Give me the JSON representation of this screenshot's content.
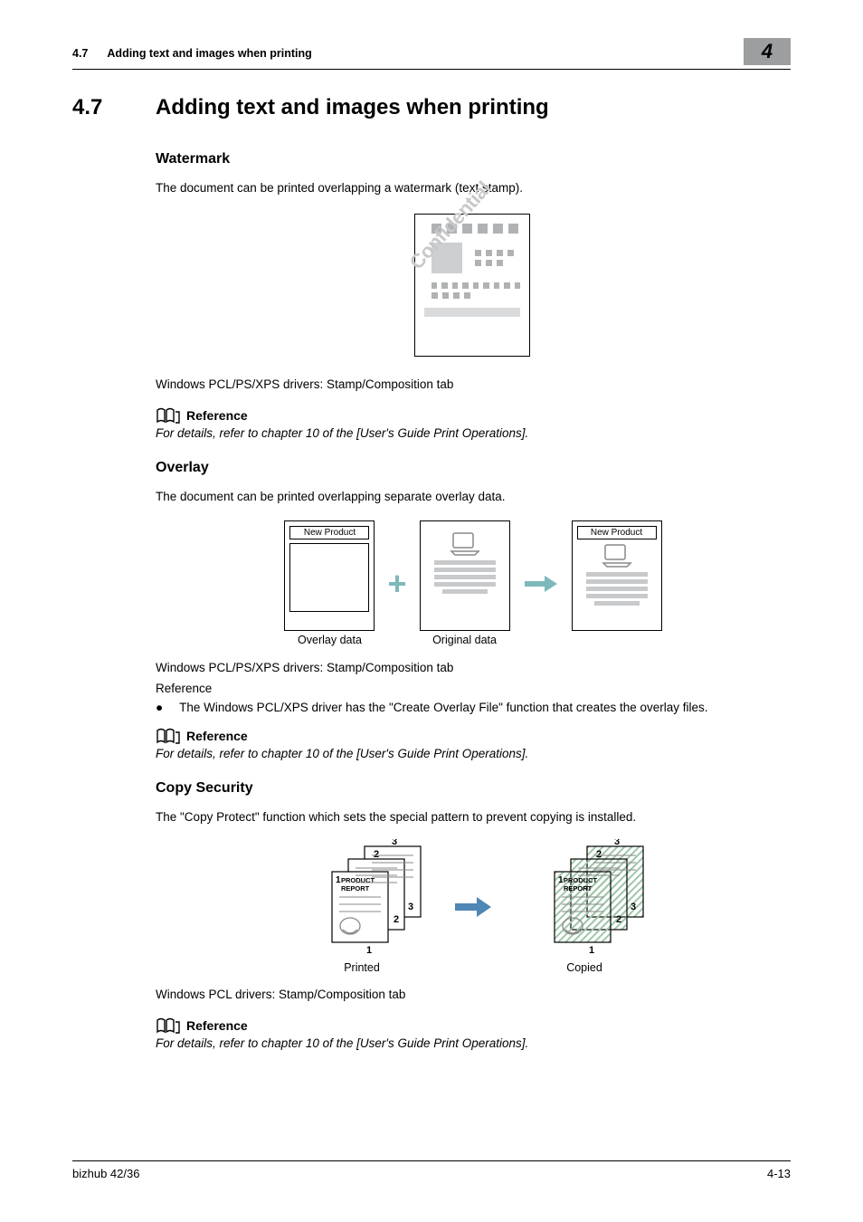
{
  "header": {
    "section_number": "4.7",
    "section_text": "Adding text and images when printing",
    "chapter_number": "4"
  },
  "section": {
    "number": "4.7",
    "title": "Adding text and images when printing"
  },
  "watermark": {
    "heading": "Watermark",
    "desc": "The document can be printed overlapping a watermark (text stamp).",
    "stamp_text": "Confidential",
    "drivers_line": "Windows PCL/PS/XPS drivers: Stamp/Composition tab",
    "reference_label": "Reference",
    "reference_text": "For details, refer to chapter 10 of the [User's Guide Print Operations]."
  },
  "overlay": {
    "heading": "Overlay",
    "desc": "The document can be printed overlapping separate overlay data.",
    "box_label": "New Product",
    "caption_left": "Overlay data",
    "caption_mid": "Original data",
    "drivers_line": "Windows PCL/PS/XPS drivers: Stamp/Composition tab",
    "reference_word": "Reference",
    "bullet": "The Windows PCL/XPS driver has the \"Create Overlay File\" function that creates the overlay files.",
    "reference_label": "Reference",
    "reference_text": "For details, refer to chapter 10 of the [User's Guide Print Operations]."
  },
  "copy_security": {
    "heading": "Copy Security",
    "desc": "The \"Copy Protect\" function which sets the special pattern to prevent copying is installed.",
    "label1": "PRODUCT",
    "label2": "REPORT",
    "caption_left": "Printed",
    "caption_right": "Copied",
    "drivers_line": "Windows PCL drivers: Stamp/Composition tab",
    "reference_label": "Reference",
    "reference_text": "For details, refer to chapter 10 of the [User's Guide Print Operations]."
  },
  "footer": {
    "product": "bizhub 42/36",
    "page": "4-13"
  }
}
